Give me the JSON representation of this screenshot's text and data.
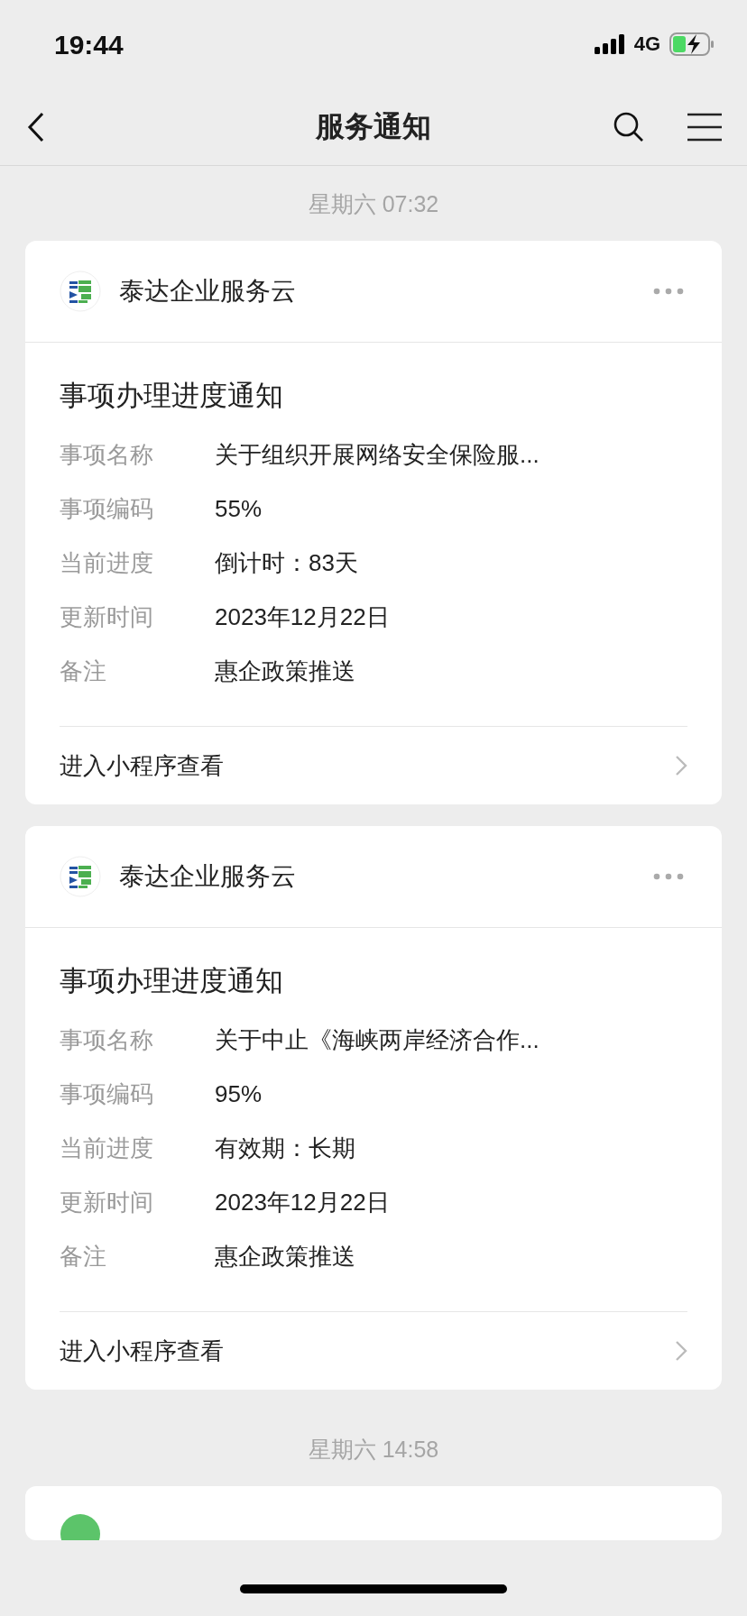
{
  "status_bar": {
    "time": "19:44",
    "network": "4G"
  },
  "nav": {
    "title": "服务通知"
  },
  "feed": [
    {
      "kind": "time",
      "text": "星期六 07:32"
    },
    {
      "kind": "card",
      "app": "泰达企业服务云",
      "title": "事项办理进度通知",
      "fields": [
        {
          "label": "事项名称",
          "value": "关于组织开展网络安全保险服..."
        },
        {
          "label": "事项编码",
          "value": "55%"
        },
        {
          "label": "当前进度",
          "value": "倒计时：83天"
        },
        {
          "label": "更新时间",
          "value": "2023年12月22日"
        },
        {
          "label": "备注",
          "value": "惠企政策推送"
        }
      ],
      "action": "进入小程序查看"
    },
    {
      "kind": "card",
      "app": "泰达企业服务云",
      "title": "事项办理进度通知",
      "fields": [
        {
          "label": "事项名称",
          "value": "关于中止《海峡两岸经济合作..."
        },
        {
          "label": "事项编码",
          "value": "95%"
        },
        {
          "label": "当前进度",
          "value": "有效期：长期"
        },
        {
          "label": "更新时间",
          "value": "2023年12月22日"
        },
        {
          "label": "备注",
          "value": "惠企政策推送"
        }
      ],
      "action": "进入小程序查看"
    },
    {
      "kind": "time",
      "text": "星期六 14:58"
    },
    {
      "kind": "card-edge"
    }
  ]
}
